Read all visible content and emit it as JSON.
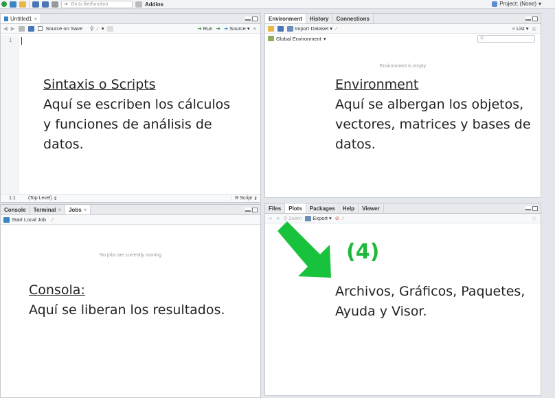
{
  "toolbar": {
    "goto_placeholder": "Go to file/function",
    "addins_label": "Addins",
    "project_label": "Project: (None)"
  },
  "source_pane": {
    "tab_label": "Untitled1",
    "source_on_save_label": "Source on Save",
    "run_label": "Run",
    "source_label": "Source",
    "line_number": "1",
    "cursor_pos": "1:1",
    "scope_label": "(Top Level)",
    "file_type": "R Script",
    "heading": "Sintaxis o Scripts",
    "lines": [
      "Aquí se escriben los cálculos",
      "y funciones de análisis de",
      "datos."
    ]
  },
  "env_pane": {
    "tabs": [
      "Environment",
      "History",
      "Connections"
    ],
    "import_label": "Import Dataset",
    "list_label": "List",
    "global_env_label": "Global Environment",
    "empty_msg": "Environment is empty",
    "heading": "Environment",
    "lines": [
      "Aquí se albergan los objetos,",
      "vectores, matrices y bases de",
      "datos."
    ]
  },
  "console_pane": {
    "tabs": [
      "Console",
      "Terminal",
      "Jobs"
    ],
    "start_job_label": "Start Local Job",
    "empty_msg": "No jobs are currently running",
    "heading": "Consola:",
    "lines": [
      "Aquí se liberan los resultados."
    ]
  },
  "files_pane": {
    "tabs": [
      "Files",
      "Plots",
      "Packages",
      "Help",
      "Viewer"
    ],
    "zoom_label": "Zoom",
    "export_label": "Export",
    "number_label": "(4)",
    "lines": [
      "Archivos, Gráficos, Paquetes,",
      "Ayuda y Visor."
    ]
  },
  "colors": {
    "arrow_green": "#19c23c",
    "number_green": "#1fb83a"
  }
}
